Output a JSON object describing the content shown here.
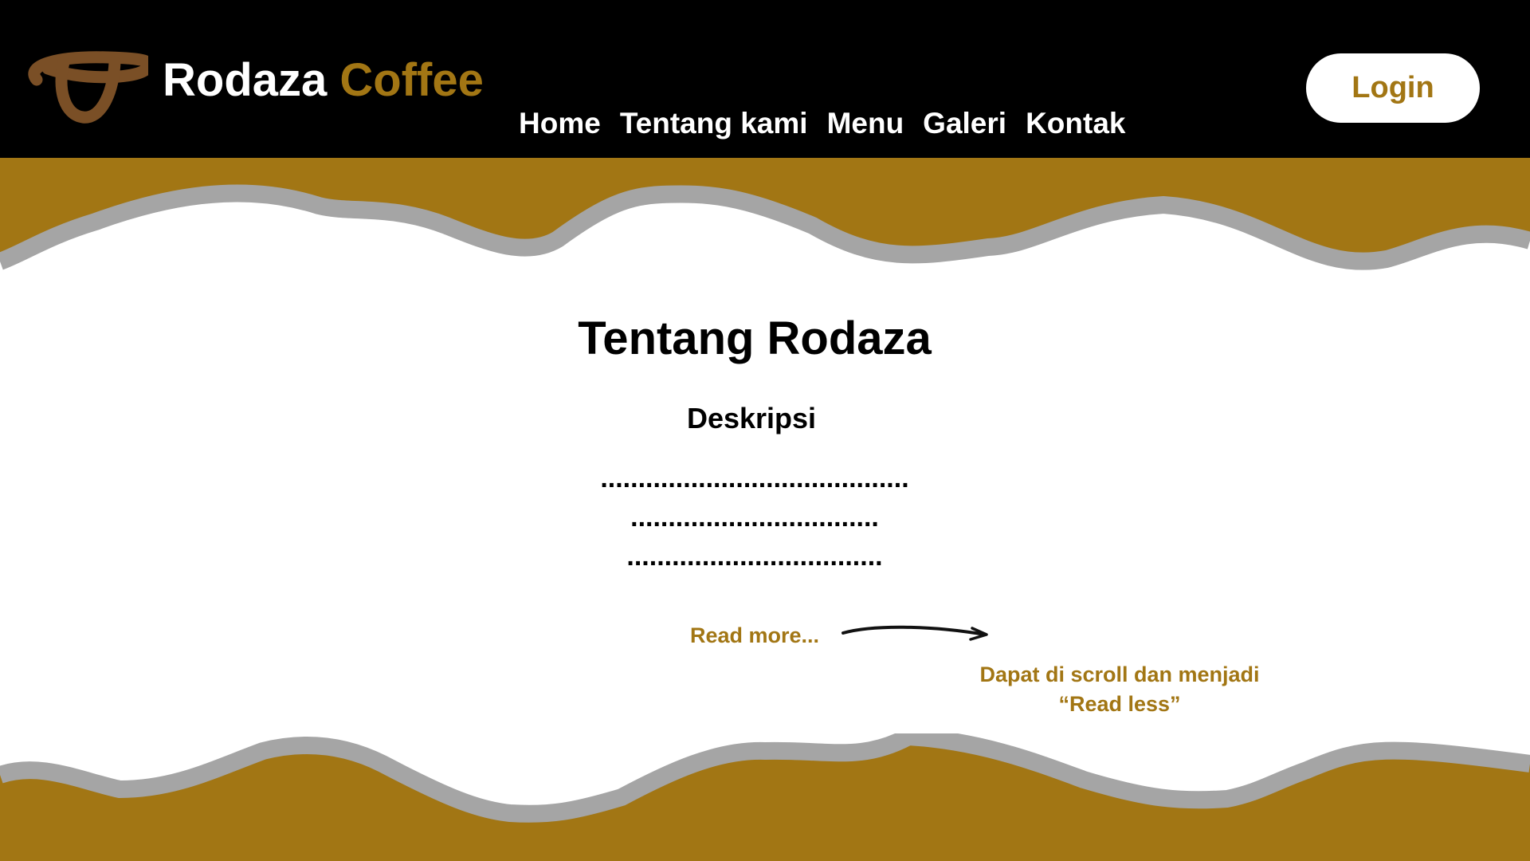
{
  "colors": {
    "header_bg": "#000000",
    "accent_gold": "#a27614",
    "wave_gray": "#a5a5a5",
    "logo_brown": "#7a4f26",
    "page_bg": "#ffffff"
  },
  "header": {
    "logo_icon": "coffee-bean-logo-icon",
    "brand_primary": "Rodaza",
    "brand_secondary": "Coffee",
    "nav": [
      "Home",
      "Tentang kami",
      "Menu",
      "Galeri",
      "Kontak"
    ],
    "login_label": "Login"
  },
  "main": {
    "title": "Tentang Rodaza",
    "subtitle": "Deskripsi",
    "description_lines": [
      ".........................................",
      ".................................",
      ".................................."
    ],
    "read_more_label": "Read more...",
    "annotation": "Dapat di scroll dan menjadi “Read less”"
  }
}
